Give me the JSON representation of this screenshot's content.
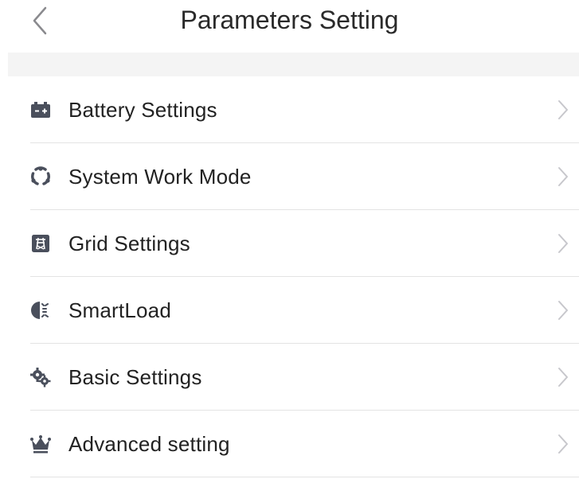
{
  "header": {
    "title": "Parameters Setting",
    "back_icon": "chevron-left-icon"
  },
  "menu": {
    "items": [
      {
        "label": "Battery Settings",
        "icon": "battery-icon"
      },
      {
        "label": "System Work Mode",
        "icon": "cycle-icon"
      },
      {
        "label": "Grid Settings",
        "icon": "grid-tower-icon"
      },
      {
        "label": "SmartLoad",
        "icon": "smartload-icon"
      },
      {
        "label": "Basic Settings",
        "icon": "gears-icon"
      },
      {
        "label": "Advanced setting",
        "icon": "crown-icon"
      }
    ]
  },
  "colors": {
    "text": "#222222",
    "icon": "#4a4f5c",
    "chevron": "#c7c7cc",
    "separator": "#e3e3e3",
    "band": "#f4f4f4"
  }
}
